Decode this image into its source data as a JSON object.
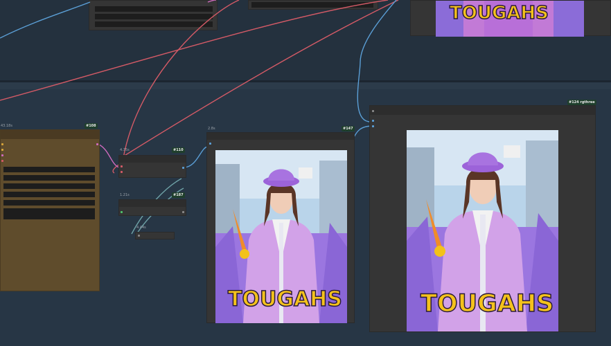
{
  "nodes": [
    {
      "id": "108",
      "badge": "#108",
      "time": "43.18s"
    },
    {
      "id": "110",
      "badge": "#110",
      "time": "4.35s"
    },
    {
      "id": "187",
      "badge": "#187",
      "time": "1.21s"
    },
    {
      "id": "small",
      "time": "4.44s"
    },
    {
      "id": "147",
      "badge": "#147",
      "time": "2.8s"
    },
    {
      "id": "124",
      "badge": "#124 rgthree"
    }
  ],
  "image_text": "TOUGAHS",
  "colors": {
    "canvas": "#273645",
    "node_body": "#353535",
    "note_node": "#5f4c2c",
    "badge_bg": "#1f3f2c",
    "link_red": "#d35a66",
    "link_blue": "#5b9fd6",
    "link_teal": "#6fa3a8",
    "link_pink": "#d06bbf"
  }
}
